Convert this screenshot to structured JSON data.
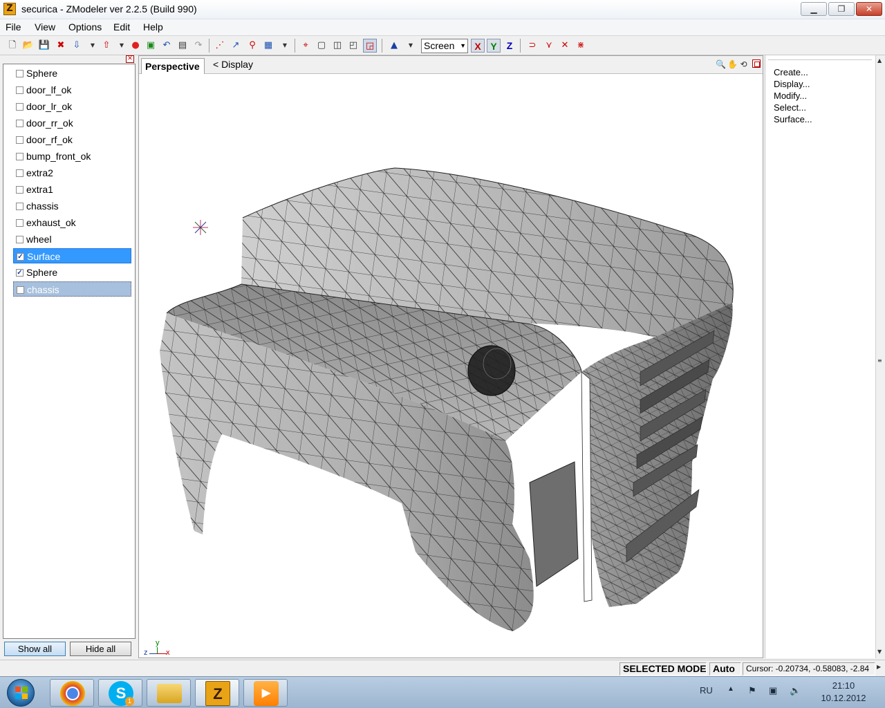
{
  "window": {
    "title": "securica - ZModeler ver 2.2.5 (Build 990)",
    "app_icon_letter": "Z"
  },
  "menu": [
    "File",
    "View",
    "Options",
    "Edit",
    "Help"
  ],
  "toolbar": {
    "view_select": "Screen",
    "axes": {
      "x": "X",
      "y": "Y",
      "z": "Z"
    },
    "colors": {
      "x": "#c00000",
      "y": "#008000",
      "z": "#0000c0"
    }
  },
  "objects": [
    {
      "label": "Sphere",
      "checked": false
    },
    {
      "label": "door_lf_ok",
      "checked": false
    },
    {
      "label": "door_lr_ok",
      "checked": false
    },
    {
      "label": "door_rr_ok",
      "checked": false
    },
    {
      "label": "door_rf_ok",
      "checked": false
    },
    {
      "label": "bump_front_ok",
      "checked": false
    },
    {
      "label": "extra2",
      "checked": false
    },
    {
      "label": "extra1",
      "checked": false
    },
    {
      "label": "chassis",
      "checked": false
    },
    {
      "label": "exhaust_ok",
      "checked": false
    },
    {
      "label": "wheel",
      "checked": false
    },
    {
      "label": "Surface",
      "checked": true,
      "state": "selected"
    },
    {
      "label": "Sphere",
      "checked": true
    },
    {
      "label": "chassis",
      "checked": false,
      "state": "highlight"
    }
  ],
  "left_buttons": {
    "show_all": "Show all",
    "hide_all": "Hide all"
  },
  "viewport": {
    "tab": "Perspective",
    "breadcrumb": "< Display",
    "gizmo": {
      "z": "z",
      "y": "y",
      "x": "x"
    }
  },
  "right_panel": [
    "Create...",
    "Display...",
    "Modify...",
    "Select...",
    "Surface..."
  ],
  "status": {
    "mode": "SELECTED MODE",
    "auto": "Auto",
    "cursor": "Cursor: -0.20734, -0.58083, -2.84"
  },
  "taskbar": {
    "language": "RU",
    "time": "21:10",
    "date": "10.12.2012",
    "skype_badge": "1"
  }
}
